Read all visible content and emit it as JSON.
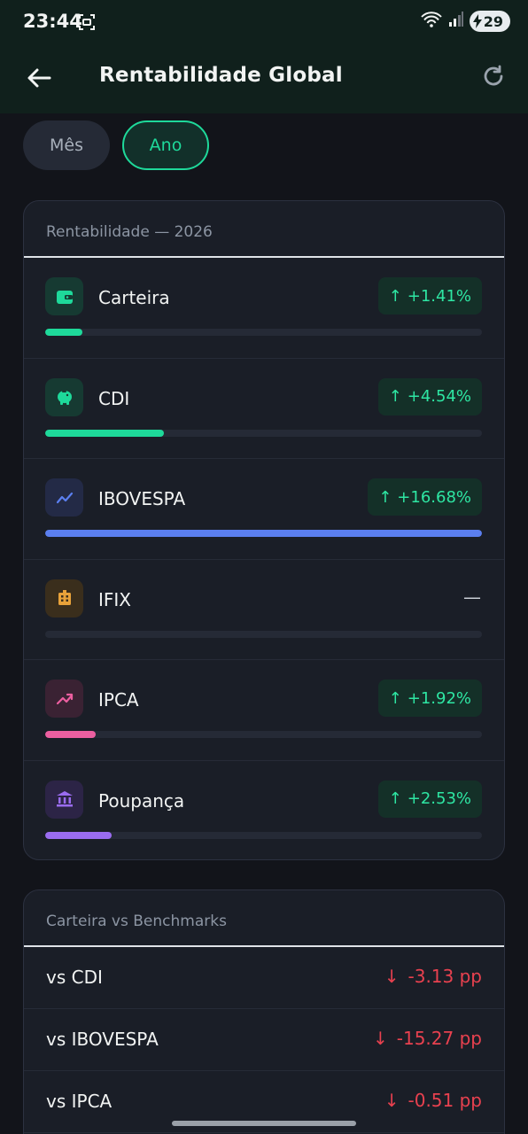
{
  "status": {
    "time": "23:44",
    "battery": "29"
  },
  "appbar": {
    "title": "Rentabilidade Global"
  },
  "period": {
    "month_label": "Mês",
    "year_label": "Ano",
    "selected": "Ano"
  },
  "returns": {
    "header": "Rentabilidade — 2026",
    "items": [
      {
        "label": "Carteira",
        "value": "+1.41%",
        "direction": "up",
        "fraction": 0.085,
        "color": "#1ed99a",
        "icon": "wallet-icon",
        "icon_bg": "#163a32"
      },
      {
        "label": "CDI",
        "value": "+4.54%",
        "direction": "up",
        "fraction": 0.272,
        "color": "#1ed99a",
        "icon": "piggy-bank-icon",
        "icon_bg": "#163a32"
      },
      {
        "label": "IBOVESPA",
        "value": "+16.68%",
        "direction": "up",
        "fraction": 1.0,
        "color": "#5b7ff0",
        "icon": "trend-line-icon",
        "icon_bg": "#232a46"
      },
      {
        "label": "IFIX",
        "value": "—",
        "direction": "none",
        "fraction": 0,
        "color": "#e8a23a",
        "icon": "building-icon",
        "icon_bg": "#3a2e1c"
      },
      {
        "label": "IPCA",
        "value": "+1.92%",
        "direction": "up",
        "fraction": 0.115,
        "color": "#ec5fa0",
        "icon": "trending-up-icon",
        "icon_bg": "#3a2233"
      },
      {
        "label": "Poupança",
        "value": "+2.53%",
        "direction": "up",
        "fraction": 0.152,
        "color": "#9a6cf0",
        "icon": "bank-icon",
        "icon_bg": "#2c2446"
      }
    ]
  },
  "benchmarks": {
    "header": "Carteira vs Benchmarks",
    "items": [
      {
        "label": "vs CDI",
        "value": "-3.13 pp",
        "direction": "down"
      },
      {
        "label": "vs IBOVESPA",
        "value": "-15.27 pp",
        "direction": "down"
      },
      {
        "label": "vs IPCA",
        "value": "-0.51 pp",
        "direction": "down"
      }
    ]
  }
}
